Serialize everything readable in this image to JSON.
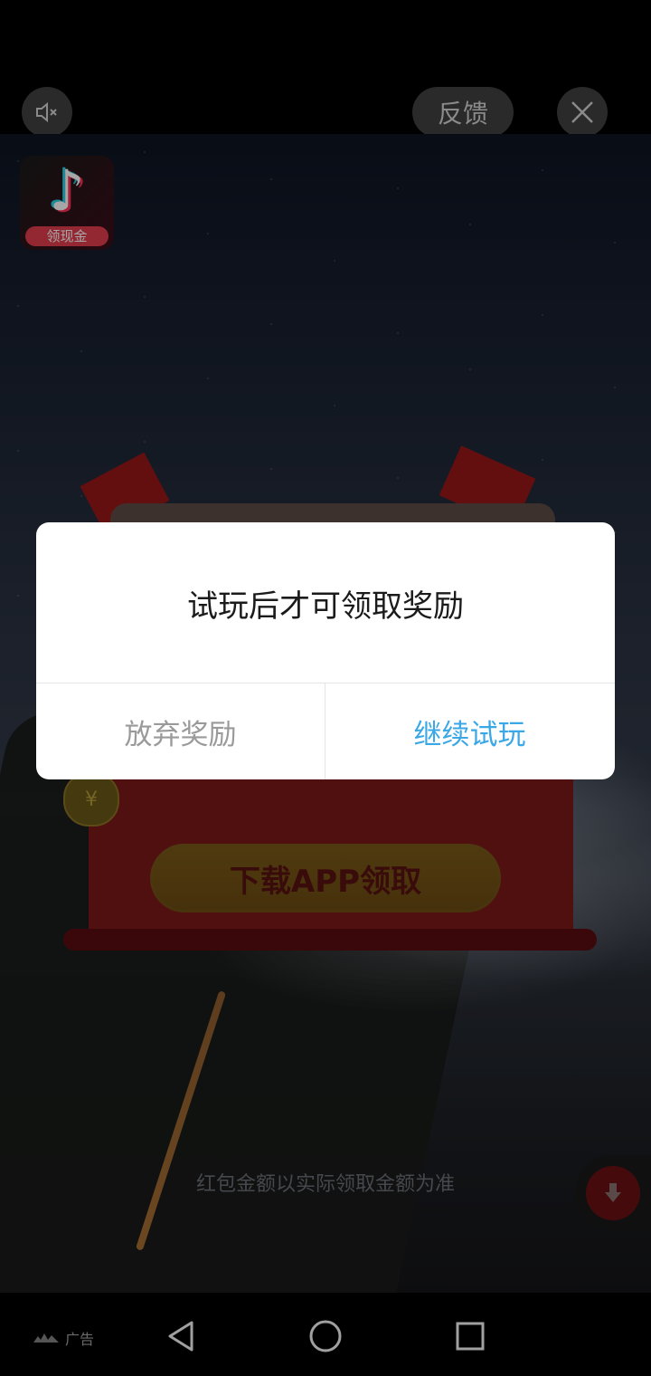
{
  "top_bar": {
    "mute_icon": "speaker-muted-icon",
    "feedback_label": "反馈",
    "close_icon": "close-icon"
  },
  "ad": {
    "app_icon": {
      "name": "tiktok-app-icon",
      "badge_text": "领现金"
    },
    "download_button_label": "下载APP领取",
    "disclaimer": "红包金额以实际领取金额为准",
    "download_fab_icon": "download-arrow-icon"
  },
  "dialog": {
    "message": "试玩后才可领取奖励",
    "dismiss_label": "放弃奖励",
    "confirm_label": "继续试玩",
    "confirm_color": "#3aa7e6",
    "dismiss_color": "#9a9a9a"
  },
  "system_nav": {
    "ad_label": "广告",
    "back_icon": "back-triangle-icon",
    "home_icon": "home-circle-icon",
    "recents_icon": "recents-square-icon"
  }
}
